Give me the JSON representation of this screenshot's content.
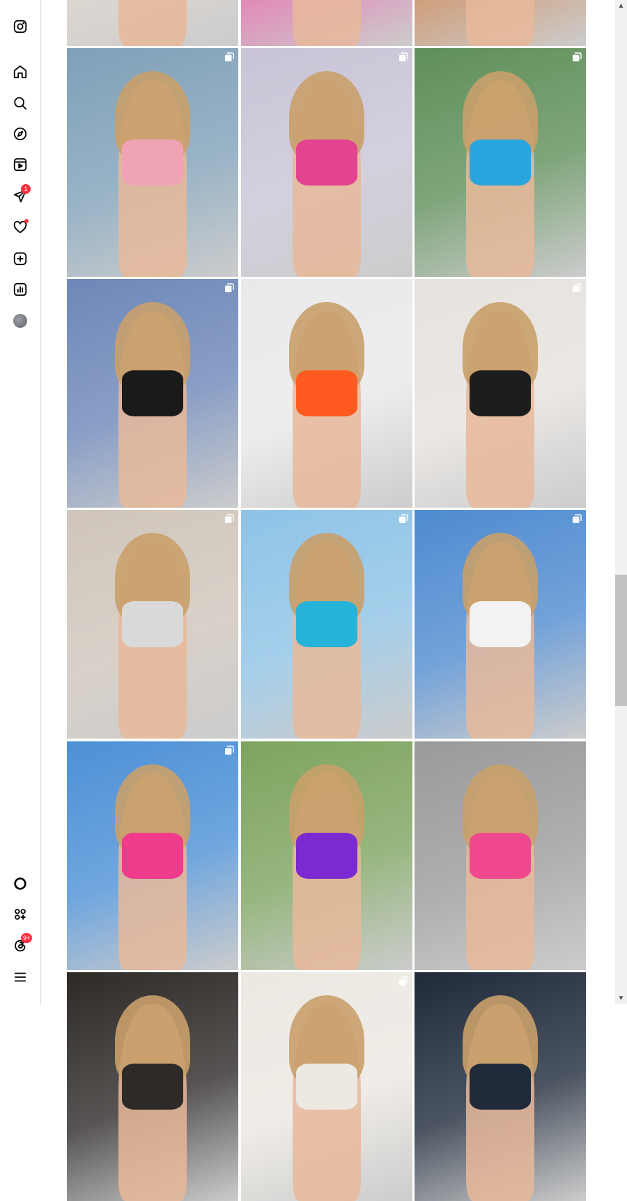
{
  "sidebar": {
    "items": [
      {
        "icon": "instagram-logo-icon"
      },
      {
        "icon": "home-icon"
      },
      {
        "icon": "search-icon"
      },
      {
        "icon": "explore-compass-icon"
      },
      {
        "icon": "reels-icon"
      },
      {
        "icon": "messages-icon",
        "badge": "1"
      },
      {
        "icon": "notifications-heart-icon"
      },
      {
        "icon": "create-icon"
      },
      {
        "icon": "dashboard-icon"
      },
      {
        "icon": "profile-avatar"
      },
      {
        "icon": "meta-ai-icon"
      },
      {
        "icon": "also-from-meta-icon"
      },
      {
        "icon": "threads-icon",
        "badge": "9+"
      },
      {
        "icon": "more-menu-icon"
      }
    ]
  },
  "posts": [
    {
      "bg": "#d8cfc6",
      "garment": "#1c1c1c",
      "multi": false
    },
    {
      "bg": "#e05aa0",
      "garment": "#e0479a",
      "multi": false
    },
    {
      "bg": "#c47a44",
      "garment": "#1c1c1c",
      "multi": false
    },
    {
      "bg": "#7fa0b8",
      "garment": "#f1a3b6",
      "multi": true
    },
    {
      "bg": "#c9c4d6",
      "garment": "#e3438f",
      "multi": true
    },
    {
      "bg": "#5f8f5a",
      "garment": "#2aa6de",
      "multi": true
    },
    {
      "bg": "#6d87b8",
      "garment": "#1a1a1a",
      "multi": true
    },
    {
      "bg": "#e9e9ea",
      "garment": "#ff5a1f",
      "multi": false
    },
    {
      "bg": "#e6e2de",
      "garment": "#1d1d1d",
      "multi": true
    },
    {
      "bg": "#cfc5bb",
      "garment": "#d9d9d9",
      "multi": true
    },
    {
      "bg": "#8ec3e6",
      "garment": "#27b3d8",
      "multi": true
    },
    {
      "bg": "#4f8bd0",
      "garment": "#f2f2f2",
      "multi": true
    },
    {
      "bg": "#4c90d6",
      "garment": "#f03a8c",
      "multi": true
    },
    {
      "bg": "#7da45f",
      "garment": "#7a2ad0",
      "multi": false
    },
    {
      "bg": "#9a9a9c",
      "garment": "#f0488f",
      "multi": false
    },
    {
      "bg": "#2d2a28",
      "garment": "#2d2a28",
      "multi": false
    },
    {
      "bg": "#ece8e2",
      "garment": "#ece8e2",
      "multi": true
    },
    {
      "bg": "#1f2a3a",
      "garment": "#1f2a3a",
      "multi": false
    }
  ],
  "scrollbar": {
    "up": "▲",
    "down": "▼"
  }
}
